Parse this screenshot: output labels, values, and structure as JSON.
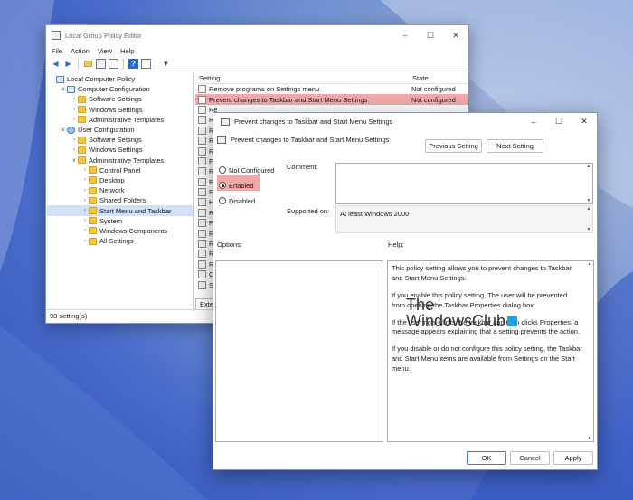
{
  "colors": {
    "highlight": "#f0a8a8",
    "accent_blue": "#3a7bd5"
  },
  "main_window": {
    "title": "Local Group Policy Editor",
    "menu": [
      "File",
      "Action",
      "View",
      "Help"
    ],
    "tree": [
      {
        "label": "Local Computer Policy",
        "depth": 0,
        "icon": "computer-icon"
      },
      {
        "label": "Computer Configuration",
        "depth": 1,
        "icon": "computer-icon",
        "expanded": true
      },
      {
        "label": "Software Settings",
        "depth": 2,
        "icon": "folder-icon"
      },
      {
        "label": "Windows Settings",
        "depth": 2,
        "icon": "folder-icon"
      },
      {
        "label": "Administrative Templates",
        "depth": 2,
        "icon": "folder-icon"
      },
      {
        "label": "User Configuration",
        "depth": 1,
        "icon": "user-icon",
        "expanded": true
      },
      {
        "label": "Software Settings",
        "depth": 2,
        "icon": "folder-icon"
      },
      {
        "label": "Windows Settings",
        "depth": 2,
        "icon": "folder-icon"
      },
      {
        "label": "Administrative Templates",
        "depth": 2,
        "icon": "folder-icon",
        "expanded": true
      },
      {
        "label": "Control Panel",
        "depth": 3,
        "icon": "folder-icon"
      },
      {
        "label": "Desktop",
        "depth": 3,
        "icon": "folder-icon"
      },
      {
        "label": "Network",
        "depth": 3,
        "icon": "folder-icon"
      },
      {
        "label": "Shared Folders",
        "depth": 3,
        "icon": "folder-icon"
      },
      {
        "label": "Start Menu and Taskbar",
        "depth": 3,
        "icon": "folder-icon",
        "selected": true
      },
      {
        "label": "System",
        "depth": 3,
        "icon": "folder-icon"
      },
      {
        "label": "Windows Components",
        "depth": 3,
        "icon": "folder-icon"
      },
      {
        "label": "All Settings",
        "depth": 3,
        "icon": "folder-icon"
      }
    ],
    "columns": {
      "setting": "Setting",
      "state": "State"
    },
    "rows": [
      {
        "setting": "Remove programs on Settings menu",
        "state": "Not configured"
      },
      {
        "setting": "Prevent changes to Taskbar and Start Menu Settings",
        "state": "Not configured",
        "highlighted": true
      },
      {
        "setting": "Re",
        "state": ""
      },
      {
        "setting": "Re",
        "state": ""
      },
      {
        "setting": "Re",
        "state": ""
      },
      {
        "setting": "Re",
        "state": ""
      },
      {
        "setting": "Re",
        "state": ""
      },
      {
        "setting": "Fo",
        "state": ""
      },
      {
        "setting": "Re",
        "state": ""
      },
      {
        "setting": "Pr",
        "state": ""
      },
      {
        "setting": "Re",
        "state": ""
      },
      {
        "setting": "Ha",
        "state": ""
      },
      {
        "setting": "Re",
        "state": ""
      },
      {
        "setting": "Pe",
        "state": ""
      },
      {
        "setting": "Re",
        "state": ""
      },
      {
        "setting": "Re",
        "state": ""
      },
      {
        "setting": "Re",
        "state": ""
      },
      {
        "setting": "Re",
        "state": ""
      },
      {
        "setting": "Cl",
        "state": ""
      },
      {
        "setting": "Sh",
        "state": ""
      }
    ],
    "tab_label": "Exte",
    "status": "98 setting(s)"
  },
  "dialog": {
    "title": "Prevent changes to Taskbar and Start Menu Settings",
    "heading": "Prevent changes to Taskbar and Start Menu Settings",
    "prev_button": "Previous Setting",
    "next_button": "Next Setting",
    "radios": {
      "not_configured": "Not Configured",
      "enabled": "Enabled",
      "disabled": "Disabled"
    },
    "selected_radio": "enabled",
    "comment_label": "Comment:",
    "supported_label": "Supported on:",
    "supported_value": "At least Windows 2000",
    "options_label": "Options:",
    "help_label": "Help:",
    "help": [
      "This policy setting allows you to prevent changes to Taskbar and Start Menu Settings.",
      "If you enable this policy setting, The user will be prevented from opening the Taskbar Properties dialog box.",
      "If the user right-clicks the taskbar and then clicks Properties, a message appears explaining that a setting prevents the action.",
      "If you disable or do not configure this policy setting, the Taskbar and Start Menu items are available from Settings on the Start menu."
    ],
    "ok": "OK",
    "cancel": "Cancel",
    "apply": "Apply"
  },
  "watermark": {
    "line1": "The",
    "line2": "WindowsClub"
  }
}
